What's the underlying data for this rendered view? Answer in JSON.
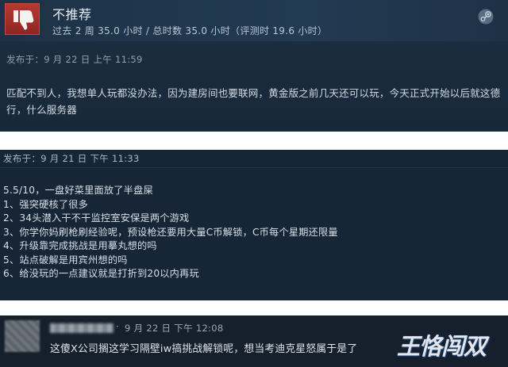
{
  "review1": {
    "verdict": "不推荐",
    "playtime": "过去 2 周 35.0 小时 / 总时数 35.0 小时（评测时 19.6 小时）",
    "posted": "发布于：9 月 22 日 上午 11:59",
    "body": "匹配不到人，我想单人玩都没办法，因为建房间也要联网，黄金版之前几天还可以玩，今天正式开始以后就这德行，什么服务器",
    "icon": "thumbs-down-icon",
    "logo": "steam-logo-icon"
  },
  "review2": {
    "posted": "发布于：9 月 21 日 下午 11:33",
    "lines": [
      "5.5/10，一盘好菜里面放了半盘屎",
      "1、强突硬核了很多",
      "2、34头潜入干不干监控室安保是两个游戏",
      "3、你学你妈刷枪刷经验呢，预设枪还要用大量C币解锁，C币每个星期还限量",
      "4、升级靠完成挑战是用摹丸想的吗",
      "5、站点破解是用宾州想的吗",
      "6、给没玩的一点建议就是打折到20以内再玩"
    ]
  },
  "comment": {
    "date": "9 月 22 日 下午 12:08",
    "separator": "·",
    "text": "这傻X公司搁这学习隔壁iw搞挑战解锁呢，想当考迪克星怒属于是了",
    "watermark": "王恪闯双"
  }
}
